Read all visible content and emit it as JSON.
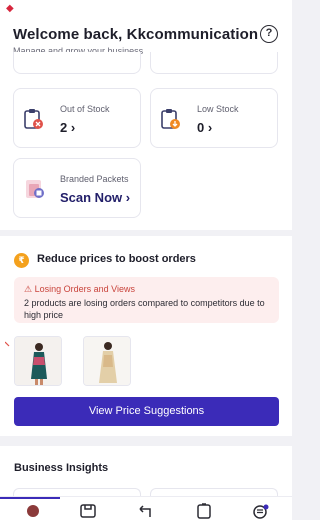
{
  "header": {
    "title": "Welcome back, Kkcommunication",
    "subtitle": "Manage and grow your business"
  },
  "stats": {
    "out_of_stock": {
      "label": "Out of Stock",
      "value": "2 ›"
    },
    "low_stock": {
      "label": "Low Stock",
      "value": "0 ›"
    },
    "branded_packets": {
      "label": "Branded Packets",
      "cta": "Scan Now ›"
    }
  },
  "price_section": {
    "title": "Reduce prices to boost orders",
    "alert_title": "⚠ Losing Orders and Views",
    "alert_body": "2 products are losing orders compared to competitors due to high price",
    "button": "View Price Suggestions"
  },
  "insights": {
    "title": "Business Insights"
  },
  "colors": {
    "accent": "#3b2bb8",
    "alert_bg": "#fdeeee",
    "alert_text": "#c9443c",
    "rupee": "#f4a11d"
  }
}
